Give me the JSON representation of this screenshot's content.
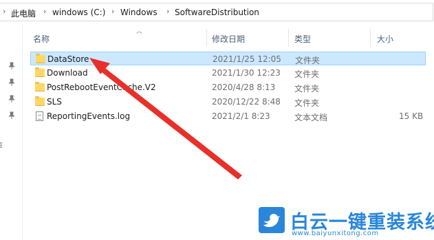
{
  "address_bar": {
    "crumbs": [
      "此电脑",
      "windows (C:)",
      "Windows",
      "SoftwareDistribution"
    ],
    "separator": "›"
  },
  "columns": {
    "name": "名称",
    "modified": "修改日期",
    "type": "类型",
    "size": "大小"
  },
  "files": [
    {
      "name": "DataStore",
      "modified": "2021/1/25 12:05",
      "type": "文件夹",
      "size": "",
      "icon": "folder-icon",
      "selected": true
    },
    {
      "name": "Download",
      "modified": "2021/1/30 12:23",
      "type": "文件夹",
      "size": "",
      "icon": "folder-icon",
      "selected": false
    },
    {
      "name": "PostRebootEventCache.V2",
      "modified": "2020/4/28 8:13",
      "type": "文件夹",
      "size": "",
      "icon": "folder-icon",
      "selected": false
    },
    {
      "name": "SLS",
      "modified": "2020/12/22 8:48",
      "type": "文件夹",
      "size": "",
      "icon": "folder-icon",
      "selected": false
    },
    {
      "name": "ReportingEvents.log",
      "modified": "2021/2/1 8:23",
      "type": "文本文档",
      "size": "15 KB",
      "icon": "text-file-icon",
      "selected": false
    }
  ],
  "watermark": {
    "title": "白云一键重装系统",
    "url": "www.baiyunxitong.com",
    "brand_color": "#2a86d9"
  },
  "colors": {
    "selection_bg": "#cce8ff",
    "selection_border": "#99d1ff",
    "arrow": "#e8302a"
  }
}
